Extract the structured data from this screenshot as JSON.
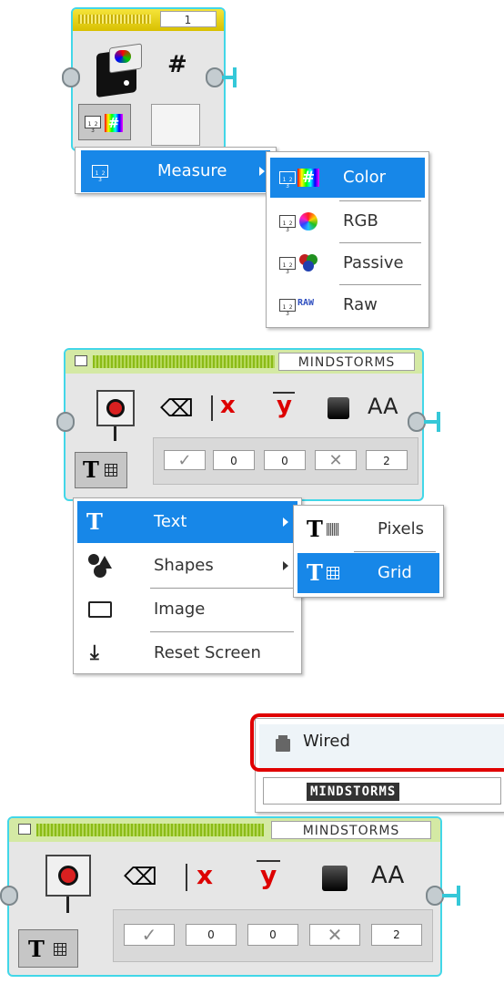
{
  "sensor_block": {
    "port": "1",
    "output_symbol": "#",
    "mode_menu": {
      "item": "Measure",
      "submenu": [
        "Color",
        "RGB",
        "Passive",
        "Raw"
      ],
      "selected": "Color"
    },
    "raw_icon_text": "RAW",
    "ico_text": "1 2 3"
  },
  "display_block_1": {
    "tag": "MINDSTORMS",
    "params": [
      "✓",
      "0",
      "0",
      "✕",
      "2"
    ],
    "font_label": "AA",
    "menu": {
      "items": [
        "Text",
        "Shapes",
        "Image",
        "Reset Screen"
      ],
      "selected": "Text"
    },
    "submenu": {
      "items": [
        "Pixels",
        "Grid"
      ],
      "selected": "Grid"
    },
    "x_label": "x",
    "y_label": "y"
  },
  "display_block_2": {
    "tag": "MINDSTORMS",
    "params": [
      "✓",
      "0",
      "0",
      "✕",
      "2"
    ],
    "font_label": "AA",
    "x_label": "x",
    "y_label": "y",
    "dropdown": {
      "option": "Wired",
      "value": "MINDSTORMS"
    }
  },
  "colors": {
    "accent": "#1787e8",
    "block_border": "#42d7e8",
    "highlight": "#e00000"
  }
}
